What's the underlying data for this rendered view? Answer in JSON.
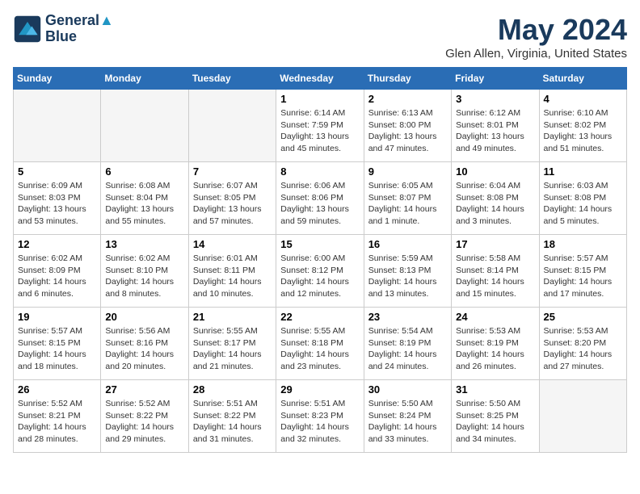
{
  "logo": {
    "line1": "General",
    "line2": "Blue"
  },
  "title": "May 2024",
  "subtitle": "Glen Allen, Virginia, United States",
  "days_of_week": [
    "Sunday",
    "Monday",
    "Tuesday",
    "Wednesday",
    "Thursday",
    "Friday",
    "Saturday"
  ],
  "weeks": [
    [
      {
        "day": "",
        "info": ""
      },
      {
        "day": "",
        "info": ""
      },
      {
        "day": "",
        "info": ""
      },
      {
        "day": "1",
        "info": "Sunrise: 6:14 AM\nSunset: 7:59 PM\nDaylight: 13 hours\nand 45 minutes."
      },
      {
        "day": "2",
        "info": "Sunrise: 6:13 AM\nSunset: 8:00 PM\nDaylight: 13 hours\nand 47 minutes."
      },
      {
        "day": "3",
        "info": "Sunrise: 6:12 AM\nSunset: 8:01 PM\nDaylight: 13 hours\nand 49 minutes."
      },
      {
        "day": "4",
        "info": "Sunrise: 6:10 AM\nSunset: 8:02 PM\nDaylight: 13 hours\nand 51 minutes."
      }
    ],
    [
      {
        "day": "5",
        "info": "Sunrise: 6:09 AM\nSunset: 8:03 PM\nDaylight: 13 hours\nand 53 minutes."
      },
      {
        "day": "6",
        "info": "Sunrise: 6:08 AM\nSunset: 8:04 PM\nDaylight: 13 hours\nand 55 minutes."
      },
      {
        "day": "7",
        "info": "Sunrise: 6:07 AM\nSunset: 8:05 PM\nDaylight: 13 hours\nand 57 minutes."
      },
      {
        "day": "8",
        "info": "Sunrise: 6:06 AM\nSunset: 8:06 PM\nDaylight: 13 hours\nand 59 minutes."
      },
      {
        "day": "9",
        "info": "Sunrise: 6:05 AM\nSunset: 8:07 PM\nDaylight: 14 hours\nand 1 minute."
      },
      {
        "day": "10",
        "info": "Sunrise: 6:04 AM\nSunset: 8:08 PM\nDaylight: 14 hours\nand 3 minutes."
      },
      {
        "day": "11",
        "info": "Sunrise: 6:03 AM\nSunset: 8:08 PM\nDaylight: 14 hours\nand 5 minutes."
      }
    ],
    [
      {
        "day": "12",
        "info": "Sunrise: 6:02 AM\nSunset: 8:09 PM\nDaylight: 14 hours\nand 6 minutes."
      },
      {
        "day": "13",
        "info": "Sunrise: 6:02 AM\nSunset: 8:10 PM\nDaylight: 14 hours\nand 8 minutes."
      },
      {
        "day": "14",
        "info": "Sunrise: 6:01 AM\nSunset: 8:11 PM\nDaylight: 14 hours\nand 10 minutes."
      },
      {
        "day": "15",
        "info": "Sunrise: 6:00 AM\nSunset: 8:12 PM\nDaylight: 14 hours\nand 12 minutes."
      },
      {
        "day": "16",
        "info": "Sunrise: 5:59 AM\nSunset: 8:13 PM\nDaylight: 14 hours\nand 13 minutes."
      },
      {
        "day": "17",
        "info": "Sunrise: 5:58 AM\nSunset: 8:14 PM\nDaylight: 14 hours\nand 15 minutes."
      },
      {
        "day": "18",
        "info": "Sunrise: 5:57 AM\nSunset: 8:15 PM\nDaylight: 14 hours\nand 17 minutes."
      }
    ],
    [
      {
        "day": "19",
        "info": "Sunrise: 5:57 AM\nSunset: 8:15 PM\nDaylight: 14 hours\nand 18 minutes."
      },
      {
        "day": "20",
        "info": "Sunrise: 5:56 AM\nSunset: 8:16 PM\nDaylight: 14 hours\nand 20 minutes."
      },
      {
        "day": "21",
        "info": "Sunrise: 5:55 AM\nSunset: 8:17 PM\nDaylight: 14 hours\nand 21 minutes."
      },
      {
        "day": "22",
        "info": "Sunrise: 5:55 AM\nSunset: 8:18 PM\nDaylight: 14 hours\nand 23 minutes."
      },
      {
        "day": "23",
        "info": "Sunrise: 5:54 AM\nSunset: 8:19 PM\nDaylight: 14 hours\nand 24 minutes."
      },
      {
        "day": "24",
        "info": "Sunrise: 5:53 AM\nSunset: 8:19 PM\nDaylight: 14 hours\nand 26 minutes."
      },
      {
        "day": "25",
        "info": "Sunrise: 5:53 AM\nSunset: 8:20 PM\nDaylight: 14 hours\nand 27 minutes."
      }
    ],
    [
      {
        "day": "26",
        "info": "Sunrise: 5:52 AM\nSunset: 8:21 PM\nDaylight: 14 hours\nand 28 minutes."
      },
      {
        "day": "27",
        "info": "Sunrise: 5:52 AM\nSunset: 8:22 PM\nDaylight: 14 hours\nand 29 minutes."
      },
      {
        "day": "28",
        "info": "Sunrise: 5:51 AM\nSunset: 8:22 PM\nDaylight: 14 hours\nand 31 minutes."
      },
      {
        "day": "29",
        "info": "Sunrise: 5:51 AM\nSunset: 8:23 PM\nDaylight: 14 hours\nand 32 minutes."
      },
      {
        "day": "30",
        "info": "Sunrise: 5:50 AM\nSunset: 8:24 PM\nDaylight: 14 hours\nand 33 minutes."
      },
      {
        "day": "31",
        "info": "Sunrise: 5:50 AM\nSunset: 8:25 PM\nDaylight: 14 hours\nand 34 minutes."
      },
      {
        "day": "",
        "info": ""
      }
    ]
  ]
}
